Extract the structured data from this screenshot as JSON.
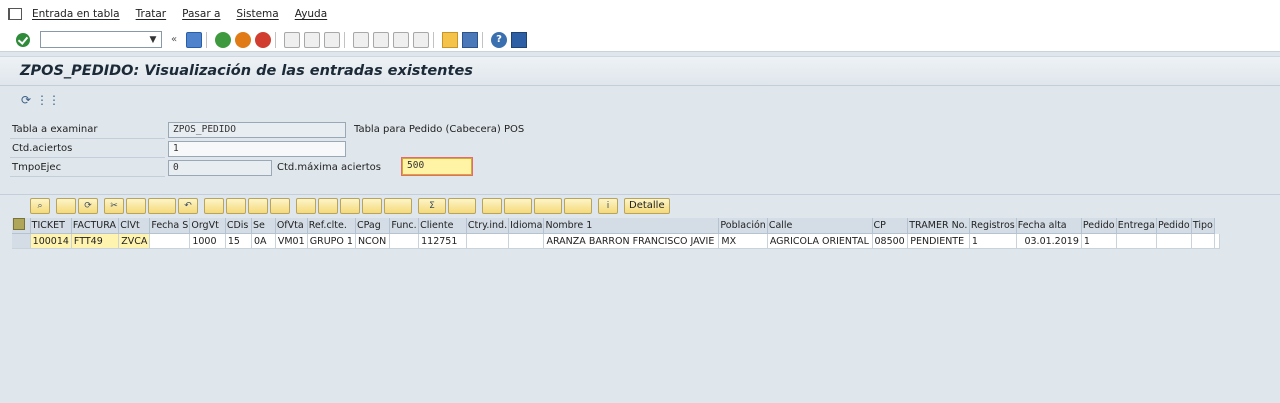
{
  "menu": {
    "items": [
      "Entrada en tabla",
      "Tratar",
      "Pasar a",
      "Sistema",
      "Ayuda"
    ]
  },
  "toolbar": {
    "command_value": "",
    "back_arrow": "«"
  },
  "title": "ZPOS_PEDIDO: Visualización de las entradas existentes",
  "form": {
    "tabla_label": "Tabla a examinar",
    "tabla_value": "ZPOS_PEDIDO",
    "tabla_desc": "Tabla para Pedido (Cabecera) POS",
    "aciertos_label": "Ctd.aciertos",
    "aciertos_value": "1",
    "tmpo_label": "TmpoEjec",
    "tmpo_value": "0",
    "maxima_label": "Ctd.máxima aciertos",
    "maxima_value": "500"
  },
  "grid_toolbar": {
    "detalle_label": "Detalle"
  },
  "grid": {
    "columns": [
      "TICKET",
      "FACTURA",
      "ClVt",
      "Fecha S",
      "OrgVt",
      "CDis",
      "Se",
      "OfVta",
      "Ref.clte.",
      "CPag",
      "Func.",
      "Cliente",
      "Ctry.ind.",
      "Idioma",
      "Nombre 1",
      "Población",
      "Calle",
      "CP",
      "TRAMER No.",
      "Registros",
      "Fecha alta",
      "Pedido",
      "Entrega",
      "Pedido",
      "Tipo"
    ],
    "rows": [
      [
        "100014",
        "FTT49",
        "ZVCA",
        "",
        "1000",
        "15",
        "0A",
        "VM01",
        "GRUPO 1",
        "NCON",
        "",
        "112751",
        "",
        "",
        "ARANZA  BARRON FRANCISCO JAVIE",
        "MX",
        "AGRICOLA ORIENTAL",
        "08500",
        "PENDIENTE",
        "1",
        "03.01.2019",
        "1",
        "",
        "",
        ""
      ]
    ]
  },
  "colors": {
    "background": "#dfe6ec",
    "key_cell": "#fff3b0",
    "active_field": "#fff3a6"
  }
}
